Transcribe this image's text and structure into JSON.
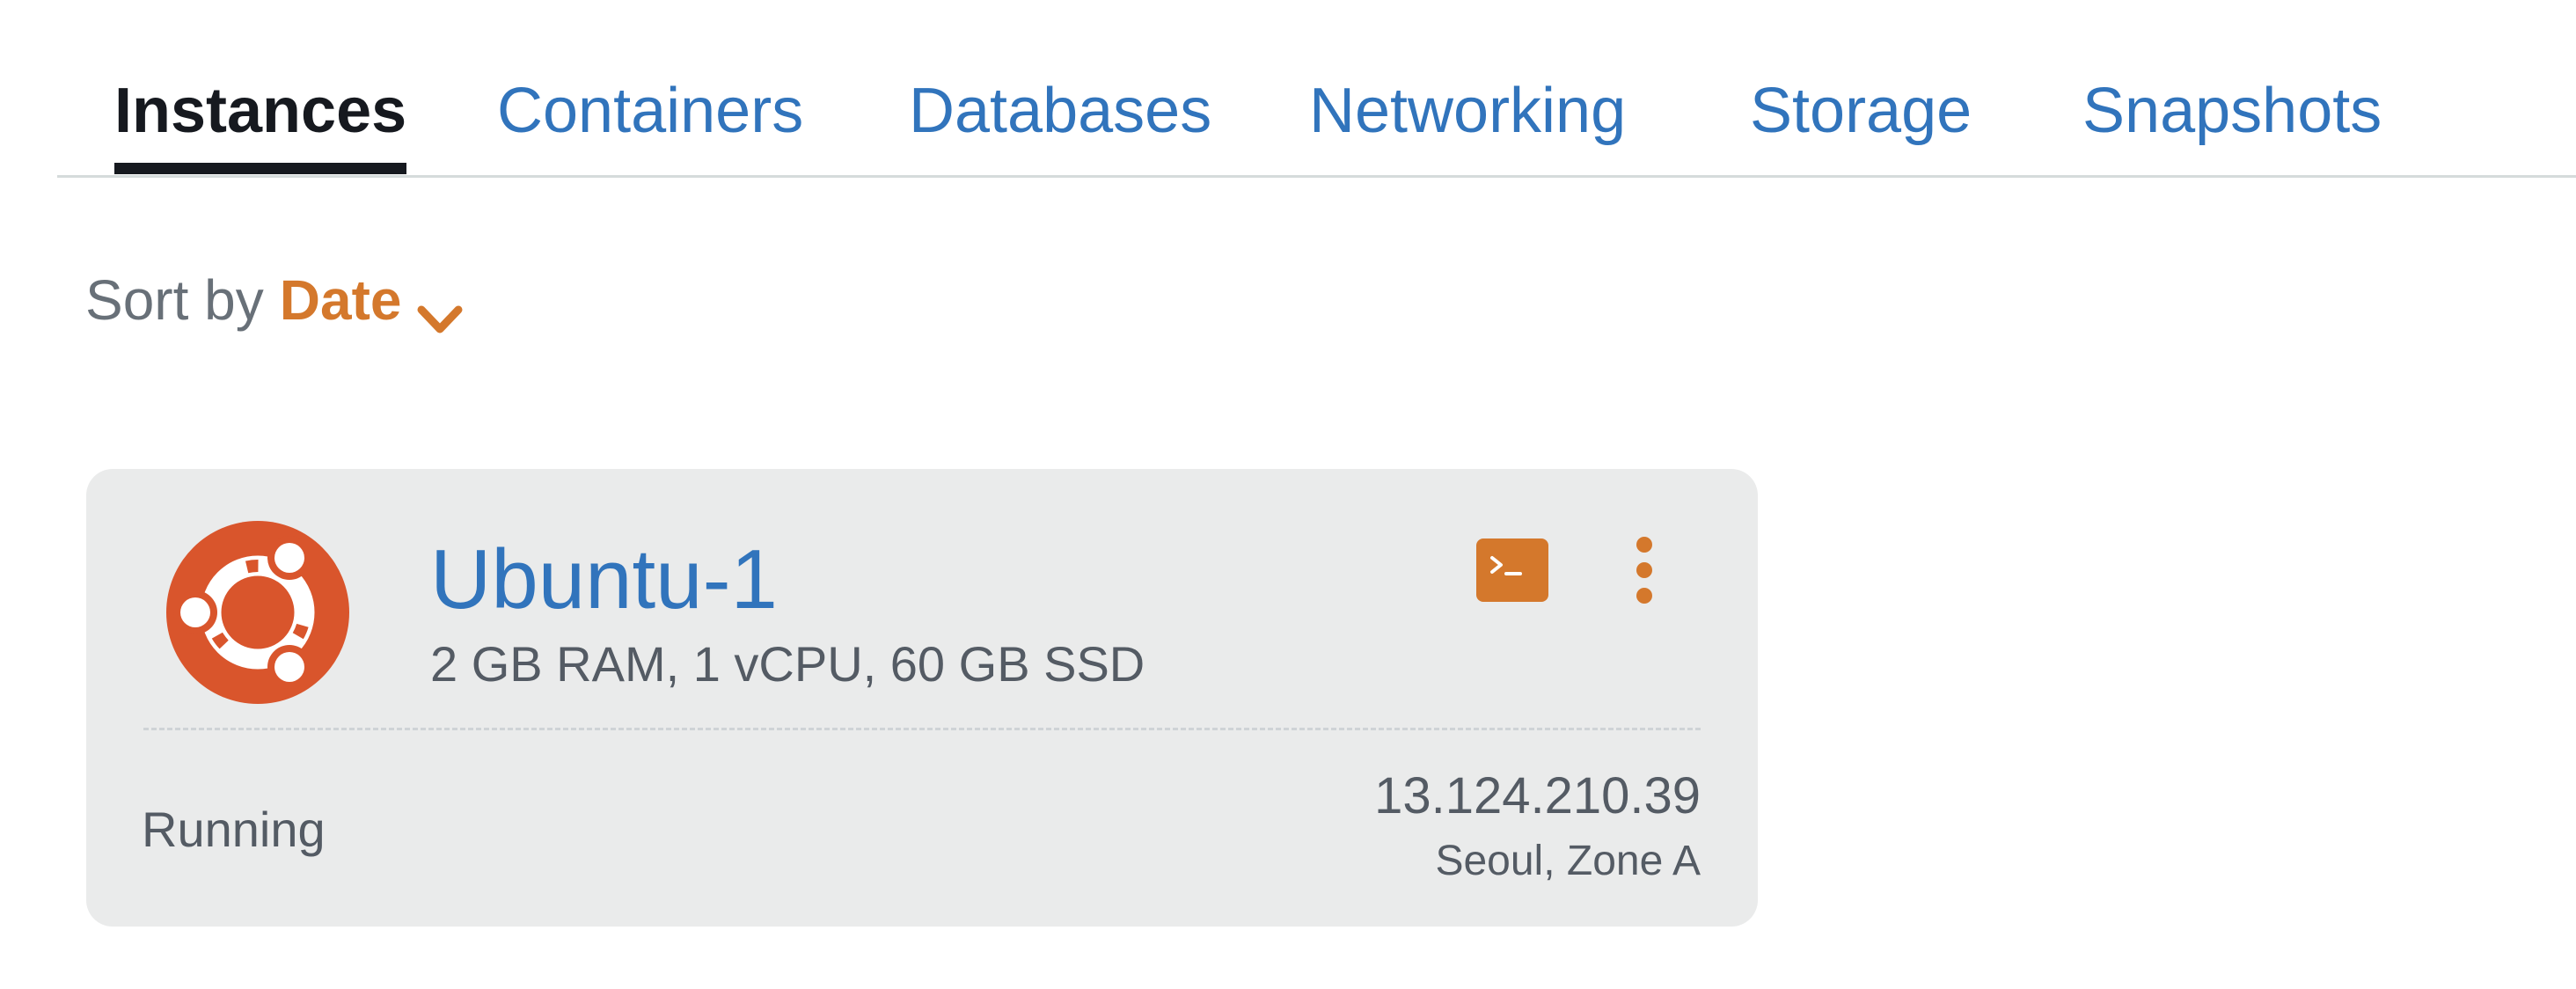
{
  "tabs": [
    {
      "label": "Instances",
      "active": true
    },
    {
      "label": "Containers",
      "active": false
    },
    {
      "label": "Databases",
      "active": false
    },
    {
      "label": "Networking",
      "active": false
    },
    {
      "label": "Storage",
      "active": false
    },
    {
      "label": "Snapshots",
      "active": false
    }
  ],
  "sort": {
    "label": "Sort by",
    "value": "Date",
    "icon": "chevron-down-icon"
  },
  "instance": {
    "name": "Ubuntu-1",
    "spec": "2 GB RAM, 1 vCPU, 60 GB SSD",
    "status": "Running",
    "ip": "13.124.210.39",
    "location": "Seoul, Zone A",
    "os_icon": "ubuntu-logo-icon",
    "actions": [
      "terminal-icon",
      "more-vertical-icon"
    ]
  },
  "colors": {
    "link": "#3174bc",
    "accent": "#d4782c",
    "ubuntu": "#d9552c",
    "card_bg": "#eaebeb",
    "text_dark": "#16191f",
    "text_muted": "#545b64"
  }
}
